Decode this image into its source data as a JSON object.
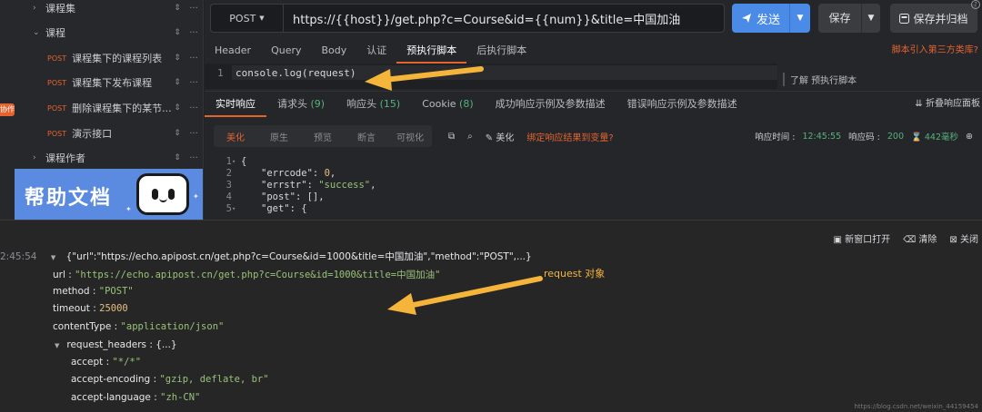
{
  "sidebar": {
    "edge_badge": "协作",
    "items": [
      {
        "type": "folder",
        "label": "课程集",
        "chevron": "›"
      },
      {
        "type": "folder",
        "label": "课程",
        "chevron": "⌄"
      },
      {
        "type": "request",
        "method": "POST",
        "label": "课程集下的课程列表"
      },
      {
        "type": "request",
        "method": "POST",
        "label": "课程集下发布课程"
      },
      {
        "type": "request",
        "method": "POST",
        "label": "删除课程集下的某节..."
      },
      {
        "type": "request",
        "method": "POST",
        "label": "演示接口"
      },
      {
        "type": "folder",
        "label": "课程作者",
        "chevron": "›"
      }
    ],
    "banner_text": "帮助文档"
  },
  "request": {
    "method": "POST",
    "url": "https://{{host}}/get.php?c=Course&id={{num}}&title=中国加油",
    "send_label": "发送",
    "save_label": "保存",
    "save_archive_label": "保存并归档"
  },
  "request_tabs": [
    "Header",
    "Query",
    "Body",
    "认证",
    "预执行脚本",
    "后执行脚本"
  ],
  "request_tab_active": "预执行脚本",
  "third_party_link": "脚本引入第三方类库?",
  "script_editor": {
    "line_number": "1",
    "code": "console.log(request)"
  },
  "script_hint": "了解 预执行脚本",
  "response_tabs": [
    {
      "label": "实时响应",
      "count": ""
    },
    {
      "label": "请求头",
      "count": "(9)"
    },
    {
      "label": "响应头",
      "count": "(15)"
    },
    {
      "label": "Cookie",
      "count": "(8)"
    },
    {
      "label": "成功响应示例及参数描述",
      "count": ""
    },
    {
      "label": "错误响应示例及参数描述",
      "count": ""
    }
  ],
  "collapse_label": "折叠响应面板",
  "view_modes": [
    "美化",
    "原生",
    "预览",
    "断言",
    "可视化"
  ],
  "view_mode_active": "美化",
  "tools": {
    "beautify": "美化",
    "bind": "绑定响应结果到变量?"
  },
  "response_meta": {
    "time_label": "响应时间 :",
    "time": "12:45:55",
    "code_label": "响应码 :",
    "code": "200",
    "duration": "442毫秒"
  },
  "json_lines": [
    {
      "n": "1",
      "fold": "▾",
      "text": "{"
    },
    {
      "n": "2",
      "fold": "",
      "key": "\"errcode\"",
      "val": "0",
      "vtype": "num"
    },
    {
      "n": "3",
      "fold": "",
      "key": "\"errstr\"",
      "val": "\"success\"",
      "vtype": "str"
    },
    {
      "n": "4",
      "fold": "",
      "key": "\"post\"",
      "val": "[]",
      "vtype": "pun"
    },
    {
      "n": "5",
      "fold": "▾",
      "key": "\"get\"",
      "val": "{",
      "vtype": "pun"
    }
  ],
  "console": {
    "open_new_window": "新窗口打开",
    "clear": "清除",
    "close": "关闭",
    "timestamp": "2:45:54",
    "summary": "{\"url\":\"https://echo.apipost.cn/get.php?c=Course&id=1000&title=中国加油\",\"method\":\"POST\",...}",
    "fields": [
      {
        "key": "url",
        "val": "\"https://echo.apipost.cn/get.php?c=Course&id=1000&title=中国加油\"",
        "vtype": "str"
      },
      {
        "key": "method",
        "val": "\"POST\"",
        "vtype": "str"
      },
      {
        "key": "timeout",
        "val": "25000",
        "vtype": "num"
      },
      {
        "key": "contentType",
        "val": "\"application/json\"",
        "vtype": "str"
      }
    ],
    "headers_label": "request_headers",
    "headers_summary": "{...}",
    "headers": [
      {
        "key": "accept",
        "val": "\"*/*\""
      },
      {
        "key": "accept-encoding",
        "val": "\"gzip, deflate, br\""
      },
      {
        "key": "accept-language",
        "val": "\"zh-CN\""
      }
    ],
    "annotation": "request 对象"
  },
  "watermark": "https://blog.csdn.net/weixin_44159454",
  "colors": {
    "accent": "#e5632f",
    "primary": "#4a8be8",
    "arrow": "#f5b53a"
  }
}
